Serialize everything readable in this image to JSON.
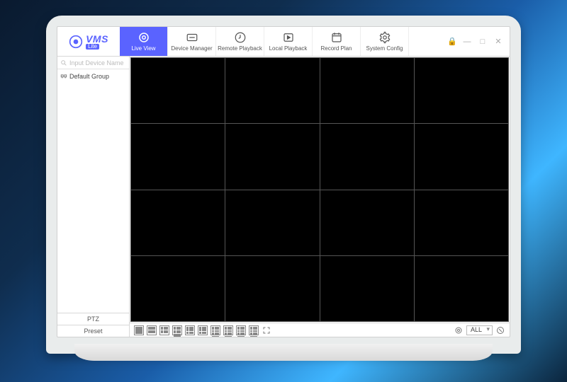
{
  "app": {
    "name": "VMS",
    "badge": "Lite"
  },
  "tabs": [
    {
      "label": "Live View"
    },
    {
      "label": "Device Manager"
    },
    {
      "label": "Remote Playback"
    },
    {
      "label": "Local Playback"
    },
    {
      "label": "Record Plan"
    },
    {
      "label": "System Config"
    }
  ],
  "sidebar": {
    "search_placeholder": "Input Device Name",
    "tree": [
      {
        "label": "Default Group"
      }
    ],
    "bottom": {
      "ptz": "PTZ",
      "preset": "Preset"
    }
  },
  "footer": {
    "dropdown": "ALL"
  }
}
